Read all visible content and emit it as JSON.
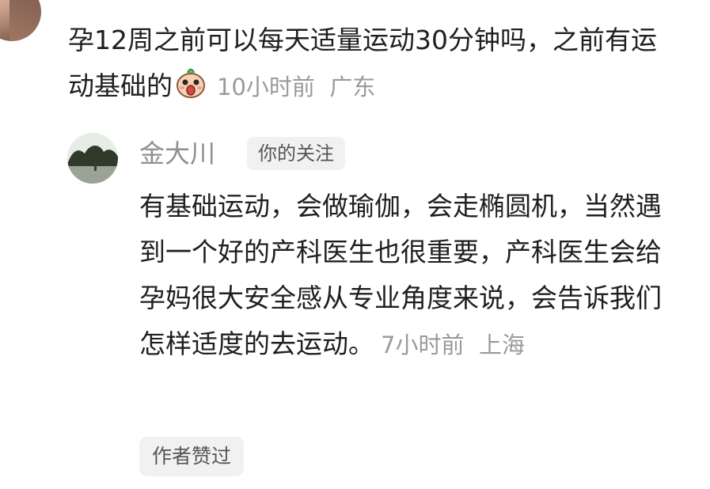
{
  "comment": {
    "text": "孕12周之前可以每天适量运动30分钟吗，之前有运动基础的",
    "emoji": "surprised-face-emoji",
    "time": "10小时前",
    "location": "广东"
  },
  "reply": {
    "author": "金大川",
    "badge": "你的关注",
    "text": "有基础运动，会做瑜伽，会走椭圆机，当然遇到一个好的产科医生也很重要，产科医生会给孕妈很大安全感从专业角度来说，会告诉我们怎样适度的去运动。",
    "time": "7小时前",
    "location": "上海",
    "liked_label": "作者赞过"
  }
}
